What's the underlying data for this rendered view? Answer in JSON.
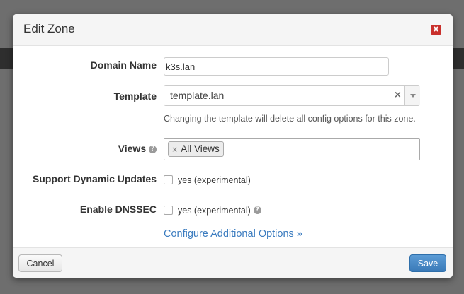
{
  "dialog": {
    "title": "Edit Zone",
    "close_icon": "close-icon",
    "close_glyph": "✖"
  },
  "form": {
    "domain_name": {
      "label": "Domain Name",
      "value": "k3s.lan"
    },
    "template": {
      "label": "Template",
      "value": "template.lan",
      "clear_glyph": "×",
      "hint": "Changing the template will delete all config options for this zone."
    },
    "views": {
      "label": "Views",
      "help_glyph": "?",
      "tags": [
        {
          "label": "All Views",
          "remove_glyph": "×"
        }
      ]
    },
    "dynamic_updates": {
      "label": "Support Dynamic Updates",
      "option": "yes (experimental)",
      "checked": false
    },
    "dnssec": {
      "label": "Enable DNSSEC",
      "option": "yes (experimental)",
      "help_glyph": "?",
      "checked": false
    },
    "additional_options_link": "Configure Additional Options »"
  },
  "footer": {
    "cancel_label": "Cancel",
    "save_label": "Save"
  },
  "colors": {
    "close": "#c9302c",
    "save": "#4a8ac8",
    "link": "#3a7bbf"
  }
}
